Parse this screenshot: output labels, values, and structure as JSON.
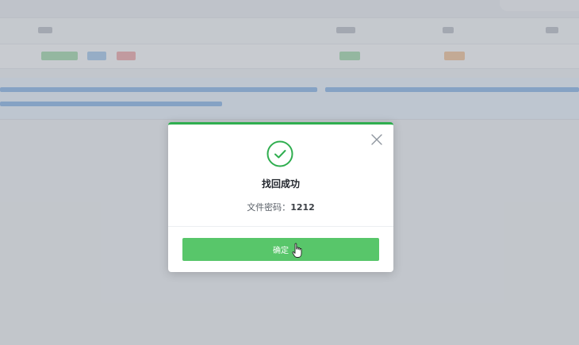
{
  "dialog": {
    "title": "找回成功",
    "message_label": "文件密码：",
    "password": "1212",
    "confirm_label": "确定",
    "accent_color": "#2fae4f",
    "button_color": "#58c66a"
  },
  "icons": {
    "success": "check-circle-icon",
    "close": "close-icon",
    "cursor": "hand-pointer-icon"
  }
}
